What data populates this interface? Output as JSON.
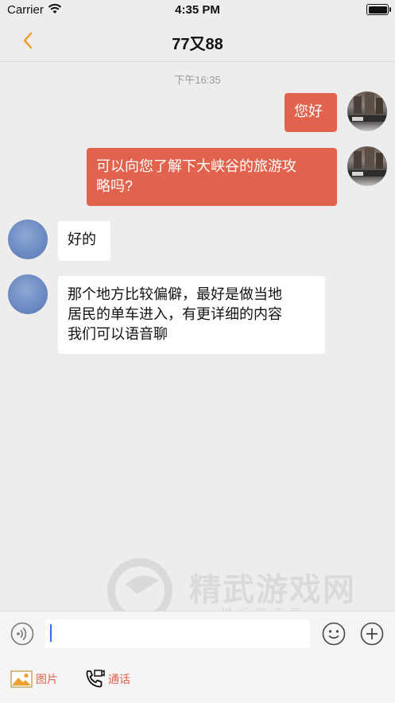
{
  "status": {
    "carrier": "Carrier",
    "time": "4:35 PM"
  },
  "nav": {
    "title": "77又88",
    "back_icon": "chevron-left-icon"
  },
  "chat": {
    "timestamp": "下午16:35",
    "messages": [
      {
        "side": "right",
        "lines": [
          "您好"
        ]
      },
      {
        "side": "right",
        "lines": [
          "可以向您了解下大峡谷的旅游攻",
          "略吗?"
        ]
      },
      {
        "side": "left",
        "lines": [
          "好的"
        ]
      },
      {
        "side": "left",
        "lines": [
          "那个地方比较偏僻，最好是做当地",
          "居民的单车进入，有更详细的内容",
          "我们可以语音聊"
        ]
      }
    ]
  },
  "watermark": {
    "main": "精武游戏网",
    "sub": "排行榜专家"
  },
  "input": {
    "value": "",
    "placeholder": ""
  },
  "toolbar": {
    "image_label": "图片",
    "call_label": "通话"
  },
  "colors": {
    "accent": "#e2634d",
    "nav_accent": "#f0a030",
    "bubble_in": "#ffffff",
    "background": "#ededed"
  }
}
